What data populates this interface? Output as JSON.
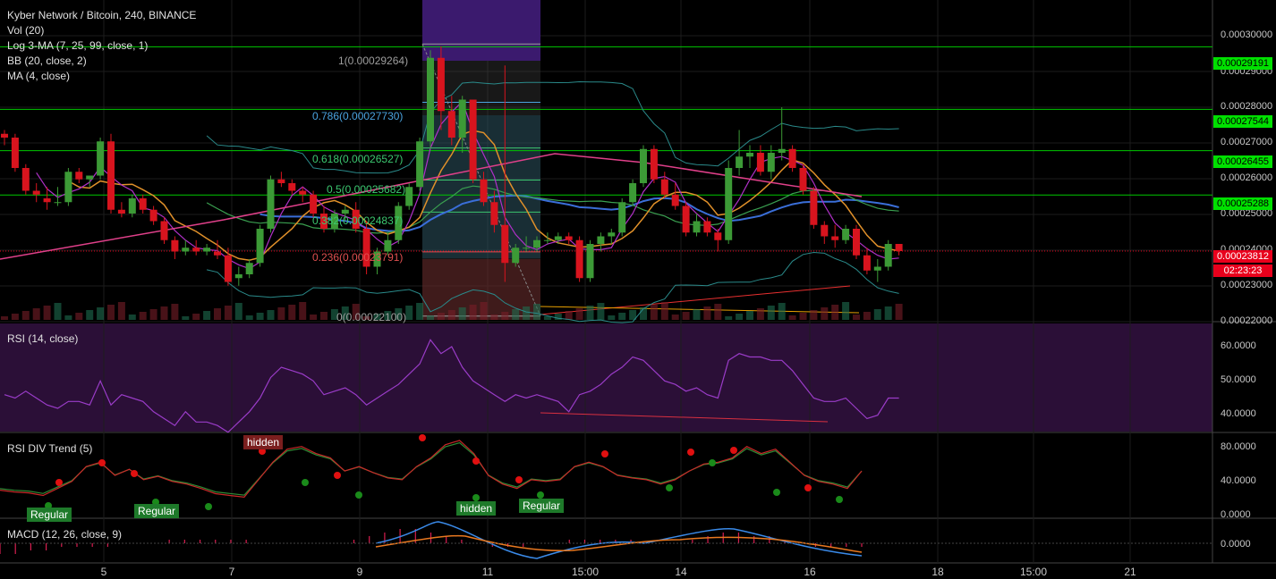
{
  "header": {
    "symbol_line": "Kyber Network / Bitcoin, 240, BINANCE",
    "indicators": [
      "Vol (20)",
      "Log 3-MA (7, 25, 99, close, 1)",
      "BB (20, close, 2)",
      "MA (4, close)"
    ]
  },
  "panes": {
    "rsi_title": "RSI (14, close)",
    "rsi_div_title": "RSI DIV Trend (5)",
    "macd_title": "MACD (12, 26, close, 9)"
  },
  "price_axis": [
    "0.00030000",
    "0.00029000",
    "0.00028000",
    "0.00027000",
    "0.00026000",
    "0.00025000",
    "0.00024000",
    "0.00023000",
    "0.00022000"
  ],
  "price_tags": [
    {
      "value": "0.00029191",
      "type": "green"
    },
    {
      "value": "0.00027544",
      "type": "green"
    },
    {
      "value": "0.00026455",
      "type": "green"
    },
    {
      "value": "0.00025288",
      "type": "green"
    },
    {
      "value": "0.00023812",
      "type": "red"
    },
    {
      "value": "02:23:23",
      "type": "red"
    }
  ],
  "rsi_axis": [
    "60.0000",
    "50.0000",
    "40.0000"
  ],
  "rsi_div_axis": [
    "80.0000",
    "40.0000",
    "0.0000"
  ],
  "macd_axis": [
    "0.0000"
  ],
  "date_labels": [
    "5",
    "7",
    "9",
    "11",
    "15:00",
    "14",
    "16",
    "18",
    "15:00",
    "21"
  ],
  "fib_labels": [
    {
      "text": "1(0.00029264)",
      "color": "#9e9e9e"
    },
    {
      "text": "0.786(0.00027730)",
      "color": "#4aa3df"
    },
    {
      "text": "0.618(0.00026527)",
      "color": "#3cc870"
    },
    {
      "text": "0.5(0.00025682)",
      "color": "#3cc870"
    },
    {
      "text": "0.382(0.00024837)",
      "color": "#3cc870"
    },
    {
      "text": "0.236(0.00023791)",
      "color": "#e05050"
    },
    {
      "text": "0(0.00022100)",
      "color": "#9e9e9e"
    }
  ],
  "div_badges": [
    {
      "text": "Regular",
      "type": "green"
    },
    {
      "text": "Regular",
      "type": "green"
    },
    {
      "text": "hidden",
      "type": "red"
    },
    {
      "text": "hidden",
      "type": "green"
    },
    {
      "text": "Regular",
      "type": "green"
    }
  ],
  "chart_data": {
    "type": "candlestick",
    "title": "Kyber Network / Bitcoin, 240, BINANCE",
    "price_range": [
      0.00022,
      0.0003
    ],
    "horizontal_levels": [
      0.00029191,
      0.00027544,
      0.00026455,
      0.00025288
    ],
    "last_price": 0.00023812,
    "candles": [
      [
        0.000269,
        0.00027,
        0.000266,
        0.000268
      ],
      [
        0.000268,
        0.000269,
        0.000259,
        0.00026
      ],
      [
        0.00026,
        0.000261,
        0.000253,
        0.000254
      ],
      [
        0.000254,
        0.000256,
        0.000251,
        0.000253
      ],
      [
        0.000252,
        0.000255,
        0.000249,
        0.000251
      ],
      [
        0.000251,
        0.000255,
        0.00025,
        0.000251
      ],
      [
        0.000251,
        0.00026,
        0.00025,
        0.000259
      ],
      [
        0.000259,
        0.00026,
        0.000256,
        0.000257
      ],
      [
        0.000257,
        0.000258,
        0.000255,
        0.000258
      ],
      [
        0.000258,
        0.000268,
        0.000257,
        0.000267
      ],
      [
        0.000267,
        0.000269,
        0.000248,
        0.000249
      ],
      [
        0.000249,
        0.000251,
        0.000247,
        0.000248
      ],
      [
        0.000248,
        0.000253,
        0.000247,
        0.000252
      ],
      [
        0.000252,
        0.000253,
        0.000248,
        0.000249
      ],
      [
        0.000249,
        0.00025,
        0.000245,
        0.000246
      ],
      [
        0.000246,
        0.000247,
        0.00024,
        0.000241
      ],
      [
        0.000241,
        0.000242,
        0.000236,
        0.000238
      ],
      [
        0.000238,
        0.000241,
        0.000237,
        0.000239
      ],
      [
        0.000239,
        0.000241,
        0.000237,
        0.000238
      ],
      [
        0.000238,
        0.00024,
        0.000237,
        0.000239
      ],
      [
        0.000238,
        0.000241,
        0.000236,
        0.000237
      ],
      [
        0.000237,
        0.000239,
        0.000229,
        0.00023
      ],
      [
        0.000231,
        0.000234,
        0.000229,
        0.000232
      ],
      [
        0.000232,
        0.000236,
        0.000231,
        0.000235
      ],
      [
        0.000235,
        0.000245,
        0.000234,
        0.000244
      ],
      [
        0.000244,
        0.000258,
        0.000243,
        0.000257
      ],
      [
        0.000257,
        0.000259,
        0.000255,
        0.000256
      ],
      [
        0.000256,
        0.000257,
        0.000253,
        0.000254
      ],
      [
        0.000254,
        0.000255,
        0.000251,
        0.000253
      ],
      [
        0.000253,
        0.000254,
        0.000247,
        0.000248
      ],
      [
        0.000248,
        0.00025,
        0.000243,
        0.000244
      ],
      [
        0.000244,
        0.000249,
        0.000243,
        0.000248
      ],
      [
        0.000248,
        0.00025,
        0.000246,
        0.000249
      ],
      [
        0.000249,
        0.000251,
        0.000243,
        0.000244
      ],
      [
        0.000244,
        0.000246,
        0.000232,
        0.000234
      ],
      [
        0.000234,
        0.000239,
        0.000232,
        0.000238
      ],
      [
        0.000238,
        0.000243,
        0.000237,
        0.000241
      ],
      [
        0.000241,
        0.000251,
        0.00024,
        0.00025
      ],
      [
        0.00025,
        0.000256,
        0.000249,
        0.000255
      ],
      [
        0.000255,
        0.000268,
        0.000254,
        0.000267
      ],
      [
        0.000267,
        0.000291,
        0.000265,
        0.000289
      ],
      [
        0.000289,
        0.000292,
        0.00027,
        0.000275
      ],
      [
        0.000275,
        0.000279,
        0.000266,
        0.000268
      ],
      [
        0.000268,
        0.000279,
        0.000264,
        0.000278
      ],
      [
        0.000278,
        0.000278,
        0.000256,
        0.000257
      ],
      [
        0.000257,
        0.000259,
        0.00025,
        0.000251
      ],
      [
        0.000251,
        0.000254,
        0.000243,
        0.000245
      ],
      [
        0.000245,
        0.000287,
        0.00023,
        0.000235
      ],
      [
        0.000235,
        0.00024,
        0.000234,
        0.000239
      ],
      [
        0.000239,
        0.000242,
        0.000238,
        0.000239
      ],
      [
        0.000239,
        0.000242,
        0.000238,
        0.000241
      ],
      [
        0.000241,
        0.000243,
        0.00024,
        0.000241
      ],
      [
        0.000241,
        0.000243,
        0.00024,
        0.000242
      ],
      [
        0.000242,
        0.000243,
        0.00024,
        0.000241
      ],
      [
        0.000241,
        0.000242,
        0.00023,
        0.000231
      ],
      [
        0.000231,
        0.000241,
        0.00023,
        0.00024
      ],
      [
        0.00024,
        0.000243,
        0.000238,
        0.000242
      ],
      [
        0.000242,
        0.000244,
        0.00024,
        0.000243
      ],
      [
        0.000243,
        0.000252,
        0.000242,
        0.000251
      ],
      [
        0.000251,
        0.000257,
        0.00025,
        0.000256
      ],
      [
        0.000256,
        0.000266,
        0.000255,
        0.000265
      ],
      [
        0.000265,
        0.000266,
        0.000256,
        0.000257
      ],
      [
        0.000257,
        0.000259,
        0.000252,
        0.000253
      ],
      [
        0.000253,
        0.000256,
        0.000249,
        0.00025
      ],
      [
        0.00025,
        0.000251,
        0.000242,
        0.000243
      ],
      [
        0.000243,
        0.000248,
        0.000242,
        0.000246
      ],
      [
        0.000246,
        0.000247,
        0.000242,
        0.000243
      ],
      [
        0.000243,
        0.000244,
        0.000238,
        0.000241
      ],
      [
        0.000241,
        0.000262,
        0.00024,
        0.00026
      ],
      [
        0.00026,
        0.00027,
        0.000258,
        0.000263
      ],
      [
        0.000263,
        0.000266,
        0.00026,
        0.000264
      ],
      [
        0.000264,
        0.000266,
        0.000258,
        0.000259
      ],
      [
        0.000259,
        0.000266,
        0.000257,
        0.000264
      ],
      [
        0.000264,
        0.000276,
        0.000262,
        0.000265
      ],
      [
        0.000265,
        0.000266,
        0.000259,
        0.00026
      ],
      [
        0.00026,
        0.000261,
        0.000253,
        0.000254
      ],
      [
        0.000254,
        0.000255,
        0.000244,
        0.000245
      ],
      [
        0.000245,
        0.000246,
        0.00024,
        0.000242
      ],
      [
        0.000242,
        0.000245,
        0.000239,
        0.000241
      ],
      [
        0.000241,
        0.000245,
        0.00024,
        0.000244
      ],
      [
        0.000244,
        0.000245,
        0.000236,
        0.000237
      ],
      [
        0.000237,
        0.000239,
        0.000232,
        0.000233
      ],
      [
        0.000233,
        0.000236,
        0.00023,
        0.000234
      ],
      [
        0.000234,
        0.000241,
        0.000233,
        0.00024
      ],
      [
        0.00024,
        0.00024,
        0.000237,
        0.00023812
      ]
    ],
    "rsi": [
      45,
      44,
      46,
      44,
      42,
      41,
      43,
      43,
      42,
      49,
      42,
      45,
      44,
      43,
      40,
      38,
      36,
      40,
      37,
      37,
      36,
      34,
      37,
      40,
      44,
      50,
      53,
      52,
      51,
      49,
      45,
      46,
      47,
      45,
      42,
      44,
      46,
      48,
      51,
      54,
      61,
      57,
      59,
      53,
      49,
      47,
      45,
      43,
      45,
      44,
      45,
      44,
      43,
      40,
      45,
      46,
      48,
      51,
      53,
      56,
      55,
      52,
      49,
      48,
      46,
      47,
      45,
      44,
      55,
      57,
      56,
      56,
      55,
      55,
      52,
      48,
      44,
      43,
      43,
      44,
      41,
      38,
      39,
      44,
      44
    ],
    "rsi_range": [
      35,
      65
    ],
    "rsi_div": [
      28,
      26,
      25,
      22,
      30,
      38,
      55,
      60,
      45,
      52,
      40,
      44,
      38,
      35,
      30,
      24,
      22,
      20,
      40,
      60,
      75,
      78,
      70,
      65,
      50,
      55,
      48,
      42,
      40,
      55,
      65,
      80,
      85,
      70,
      45,
      35,
      30,
      40,
      38,
      40,
      55,
      60,
      55,
      45,
      42,
      40,
      35,
      40,
      50,
      58,
      60,
      65,
      78,
      70,
      75,
      60,
      45,
      38,
      35,
      30,
      50
    ],
    "rsi_div_range": [
      0,
      90
    ],
    "macd": [
      -3,
      -3,
      -2,
      -2,
      -1,
      -1,
      -1,
      -1,
      0,
      0,
      0,
      1,
      1,
      1,
      1,
      1,
      1,
      0,
      0,
      0,
      0,
      0,
      0,
      1,
      2,
      3,
      4,
      4,
      3,
      2,
      1,
      0,
      -1,
      -1,
      -1,
      0,
      0,
      1,
      1,
      1,
      1,
      1,
      0,
      0,
      0,
      1,
      2,
      3,
      3,
      2,
      2,
      1,
      0,
      -1,
      -1,
      -1,
      -1
    ],
    "macd_range": [
      -4,
      5
    ],
    "x_labels": [
      "5",
      "7",
      "9",
      "11",
      "15:00",
      "14",
      "16",
      "18",
      "15:00",
      "21"
    ]
  }
}
